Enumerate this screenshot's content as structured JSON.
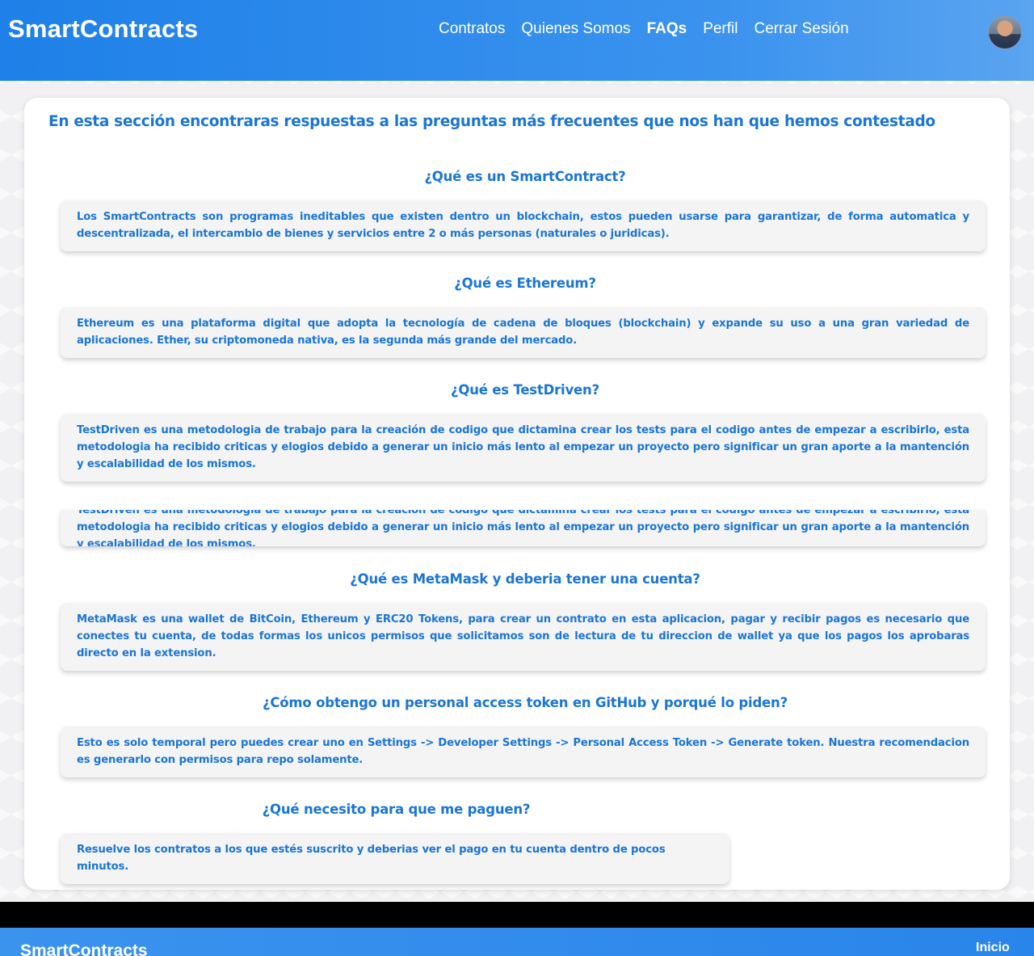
{
  "header": {
    "brand": "SmartContracts",
    "nav": [
      "Contratos",
      "Quienes Somos",
      "FAQs",
      "Perfil",
      "Cerrar Sesión"
    ],
    "active_nav": "FAQs",
    "avatar_icon": "user-avatar-photo"
  },
  "main": {
    "intro": "En esta sección encontraras respuestas a las preguntas más frecuentes que nos han que hemos contestado",
    "faqs": [
      {
        "question": "¿Qué es un SmartContract?",
        "answer": "Los SmartContracts son programas ineditables que existen dentro un blockchain, estos pueden usarse para garantizar, de forma automatica y descentralizada, el intercambio de bienes y servicios entre 2 o más personas (naturales o juridicas)."
      },
      {
        "question": "¿Qué es Ethereum?",
        "answer": "Ethereum es una plataforma digital que adopta la tecnología de cadena de bloques (blockchain) y expande su uso a una gran variedad de aplicaciones. Ether, su criptomoneda nativa, es la segunda más grande del mercado."
      },
      {
        "question": "¿Qué es TestDriven?",
        "answer": "TestDriven es una metodologia de trabajo para la creación de codigo que dictamina crear los tests para el codigo antes de empezar a escribirlo, esta metodologia ha recibido criticas y elogios debido a generar un inicio más lento al empezar un proyecto pero significar un gran aporte a la mantención y escalabilidad de los mismos."
      },
      {
        "question": "¿Qué es MetaMask y deberia tener una cuenta?",
        "answer": "MetaMask es una wallet de BitCoin, Ethereum y ERC20 Tokens, para crear un contrato en esta aplicacion, pagar y recibir pagos es necesario que conectes tu cuenta, de todas formas los unicos permisos que solicitamos son de lectura de tu direccion de wallet ya que los pagos los aprobaras directo en la extension."
      },
      {
        "question": "¿Cómo obtengo un personal access token en GitHub y porqué lo piden?",
        "answer": "Esto es solo temporal pero puedes crear uno en Settings -> Developer Settings -> Personal Access Token -> Generate token. Nuestra recomendacion es generarlo con permisos para repo solamente."
      },
      {
        "question": "¿Qué necesito para que me paguen?",
        "answer": "Resuelve los contratos a los que estés suscrito y deberias ver el pago en tu cuenta dentro de pocos minutos."
      }
    ]
  },
  "footer": {
    "brand": "SmartContracts",
    "link": "Inicio"
  },
  "colors": {
    "accent": "#1b76d3",
    "header_start": "#1e80e8",
    "header_end": "#5aa4f0",
    "answer_bg": "#f4f4f4"
  }
}
